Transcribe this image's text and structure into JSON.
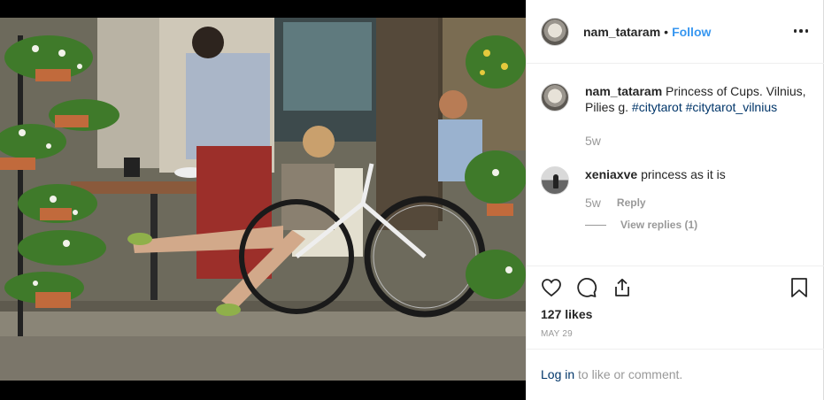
{
  "post": {
    "username": "nam_tataram",
    "separator": "•",
    "follow_label": "Follow"
  },
  "caption": {
    "username": "nam_tataram",
    "text": "Princess of Cups. Vilnius, Pilies g.",
    "tags": [
      "#citytarot",
      "#citytarot_vilnius"
    ],
    "time": "5w"
  },
  "comments": [
    {
      "username": "xeniaxve",
      "text": "princess as it is",
      "time": "5w",
      "reply_label": "Reply",
      "view_replies": "View replies (1)"
    }
  ],
  "actions": {
    "like_icon": "heart-icon",
    "comment_icon": "comment-icon",
    "share_icon": "share-icon",
    "save_icon": "bookmark-icon",
    "likes": "127 likes",
    "date": "MAY 29"
  },
  "login": {
    "link": "Log in",
    "rest": " to like or comment."
  },
  "colors": {
    "accent": "#3897f0",
    "link": "#003569",
    "muted": "#999999"
  }
}
